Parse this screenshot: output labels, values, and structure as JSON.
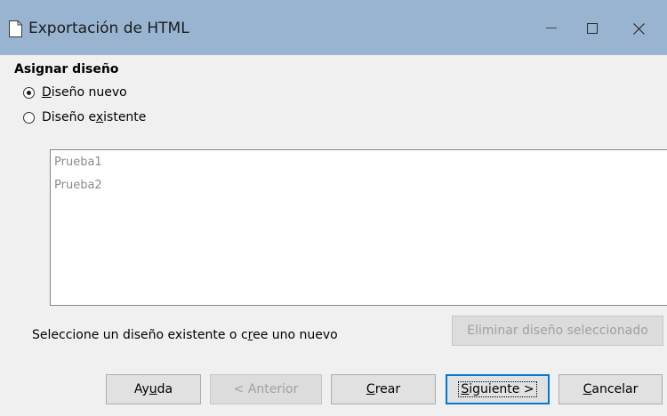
{
  "window": {
    "title": "Exportación de HTML",
    "icons": {
      "app": "document-icon",
      "minimize": "minimize-icon",
      "maximize": "maximize-icon",
      "close": "close-icon"
    }
  },
  "group": {
    "title": "Asignar diseño"
  },
  "options": {
    "new_design": {
      "mn": "D",
      "rest": "iseño nuevo",
      "selected": true
    },
    "existing_design": {
      "pre": "Diseño e",
      "mn": "x",
      "rest": "istente",
      "selected": false
    }
  },
  "designs_list": [
    "Prueba1",
    "Prueba2"
  ],
  "hint": {
    "pre": "Seleccione un diseño existente o c",
    "mn": "r",
    "rest": "ee uno nuevo"
  },
  "buttons": {
    "delete_selected": "Eliminar diseño seleccionado",
    "help": {
      "pre": "Ay",
      "mn": "u",
      "rest": "da"
    },
    "previous": "< Anterior",
    "create": {
      "mn": "C",
      "rest": "rear"
    },
    "next": {
      "mn": "S",
      "rest": "iguiente >"
    },
    "cancel": {
      "mn": "C",
      "rest": "ancelar"
    }
  },
  "colors": {
    "titlebar": "#99b4d1",
    "dialog_bg": "#f0f0f0",
    "accent": "#0078d7"
  }
}
